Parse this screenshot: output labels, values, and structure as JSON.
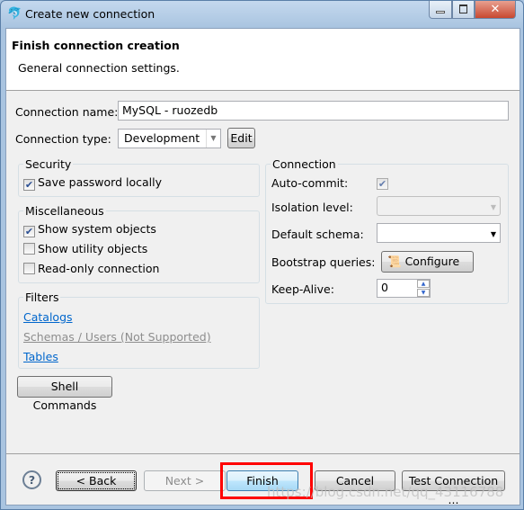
{
  "window": {
    "title": "Create new connection"
  },
  "header": {
    "title": "Finish connection creation",
    "subtitle": "General connection settings."
  },
  "form": {
    "name_label": "Connection name:",
    "name_value": "MySQL - ruozedb",
    "type_label": "Connection type:",
    "type_value": "Development",
    "edit_label": "Edit"
  },
  "security": {
    "title": "Security",
    "save_password": {
      "label": "Save password locally",
      "checked": true
    }
  },
  "misc": {
    "title": "Miscellaneous",
    "items": [
      {
        "label": "Show system objects",
        "checked": true
      },
      {
        "label": "Show utility objects",
        "checked": false
      },
      {
        "label": "Read-only connection",
        "checked": false
      }
    ]
  },
  "filters": {
    "title": "Filters",
    "links": [
      {
        "label": "Catalogs",
        "enabled": true
      },
      {
        "label": "Schemas / Users (Not Supported)",
        "enabled": false
      },
      {
        "label": "Tables",
        "enabled": true
      }
    ]
  },
  "shell_commands_label": "Shell Commands",
  "connection": {
    "title": "Connection",
    "auto_commit_label": "Auto-commit:",
    "auto_commit": true,
    "isolation_label": "Isolation level:",
    "isolation_value": "",
    "schema_label": "Default schema:",
    "schema_value": "",
    "bootstrap_label": "Bootstrap queries:",
    "configure_label": "Configure ...",
    "keepalive_label": "Keep-Alive:",
    "keepalive_value": "0"
  },
  "buttons": {
    "back": "< Back",
    "next": "Next >",
    "finish": "Finish",
    "cancel": "Cancel",
    "test": "Test Connection ..."
  },
  "watermark": "https://blog.csdn.net/qq_43116788",
  "colors": {
    "highlight": "#ff0000",
    "link": "#0066cc"
  }
}
